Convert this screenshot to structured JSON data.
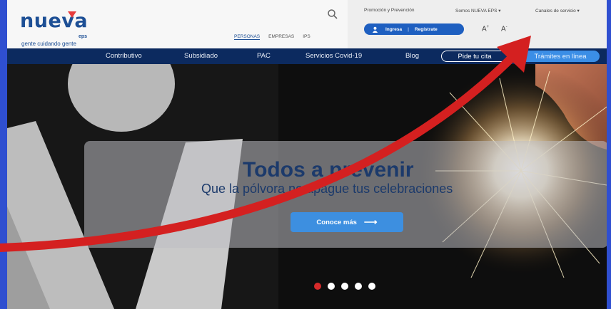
{
  "header": {
    "logo_word": "nueva",
    "logo_eps": "eps",
    "logo_tagline": "gente cuidando gente",
    "segments": [
      "PERSONAS",
      "EMPRESAS",
      "IPS"
    ],
    "top_links": [
      "Promoción y Prevención",
      "Somos NUEVA EPS ▾",
      "Canales de servicio ▾"
    ],
    "login_label": "Ingresa",
    "register_label": "Regístrate",
    "font_increase": "A",
    "font_decrease": "A"
  },
  "nav": {
    "items": [
      "Contributivo",
      "Subsidiado",
      "PAC",
      "Servicios Covid-19",
      "Blog"
    ],
    "outline_button": "Pide tu cita",
    "fill_button": "Trámites en línea"
  },
  "hero": {
    "headline": "Todos a prevenir",
    "subline": "Que la pólvora no apague tus celebraciones",
    "cta_label": "Conoce más",
    "cta_arrow": "⟶",
    "slide_count": 5,
    "active_slide": 1
  },
  "colors": {
    "brand": "#1d4f95",
    "nav_bg": "#0c2a5f",
    "accent": "#3d8fe0",
    "annotation_arrow": "#d42020",
    "outer_border": "#2f4fd0"
  }
}
